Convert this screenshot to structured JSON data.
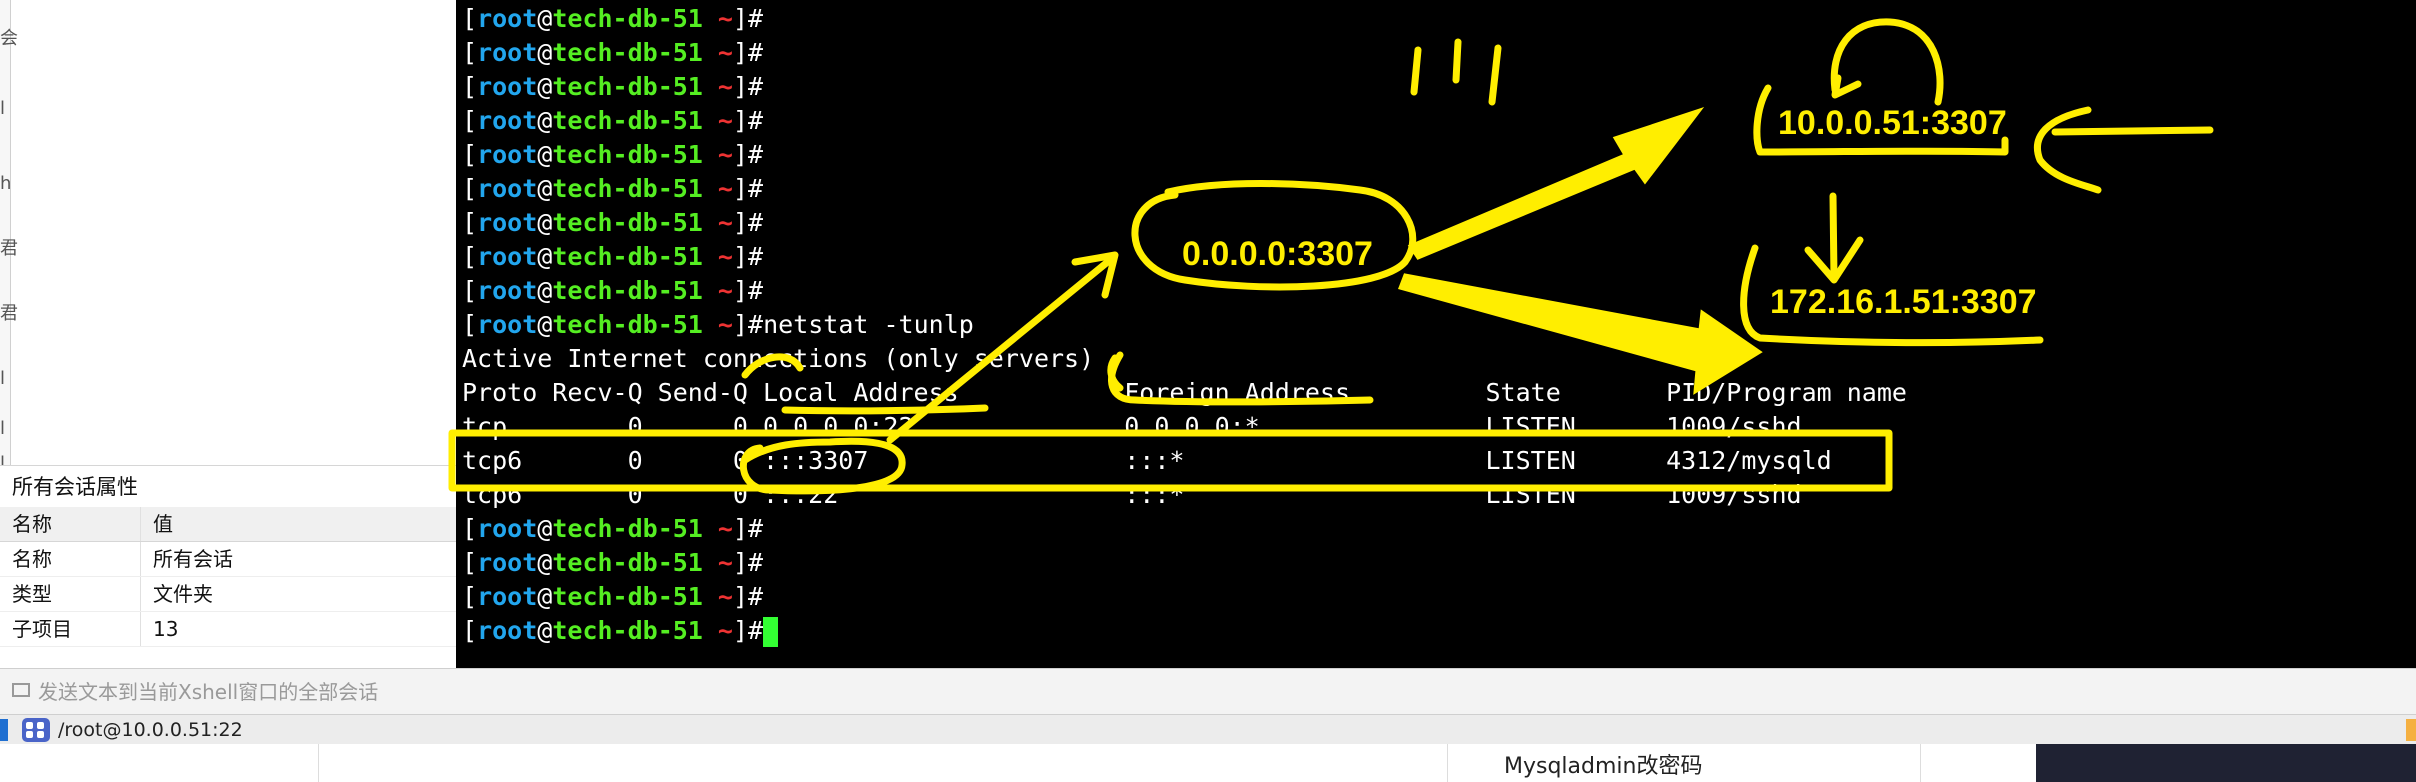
{
  "left_panel": {
    "strip_chars": [
      "会",
      "l",
      "h",
      "君",
      "君",
      "l",
      "l",
      "l"
    ],
    "properties_title": "所有会话属性",
    "table": {
      "headers": [
        "名称",
        "值"
      ],
      "rows": [
        [
          "名称",
          "所有会话"
        ],
        [
          "类型",
          "文件夹"
        ],
        [
          "子项目",
          "13"
        ]
      ]
    }
  },
  "terminal": {
    "prompt": {
      "user": "root",
      "host": "tech-db-51",
      "dir": "~"
    },
    "empty_prompt_lines_before": 9,
    "command": "netstat -tunlp",
    "output": [
      "Active Internet connections (only servers)",
      "Proto Recv-Q Send-Q Local Address           Foreign Address         State       PID/Program name",
      "tcp        0      0 0.0.0.0:22              0.0.0.0:*               LISTEN      1009/sshd",
      "tcp6       0      0 :::3307                 :::*                    LISTEN      4312/mysqld",
      "tcp6       0      0 :::22                   :::*                    LISTEN      1009/sshd"
    ],
    "empty_prompt_lines_after": 3,
    "colors": {
      "user": "#22a6ee",
      "host": "#55ee22",
      "tilde": "#ee3333",
      "cursor": "#33ff33"
    }
  },
  "annotations": {
    "color": "#ffee00",
    "labels": {
      "any_address": "0.0.0.0:3307",
      "public_address": "10.0.0.51:3307",
      "private_address": "172.16.1.51:3307"
    }
  },
  "send_bar": {
    "placeholder": "发送文本到当前Xshell窗口的全部会话"
  },
  "status_bar": {
    "session": "/root@10.0.0.51:22"
  },
  "background_page": {
    "text": "Mysqladmin改密码"
  }
}
